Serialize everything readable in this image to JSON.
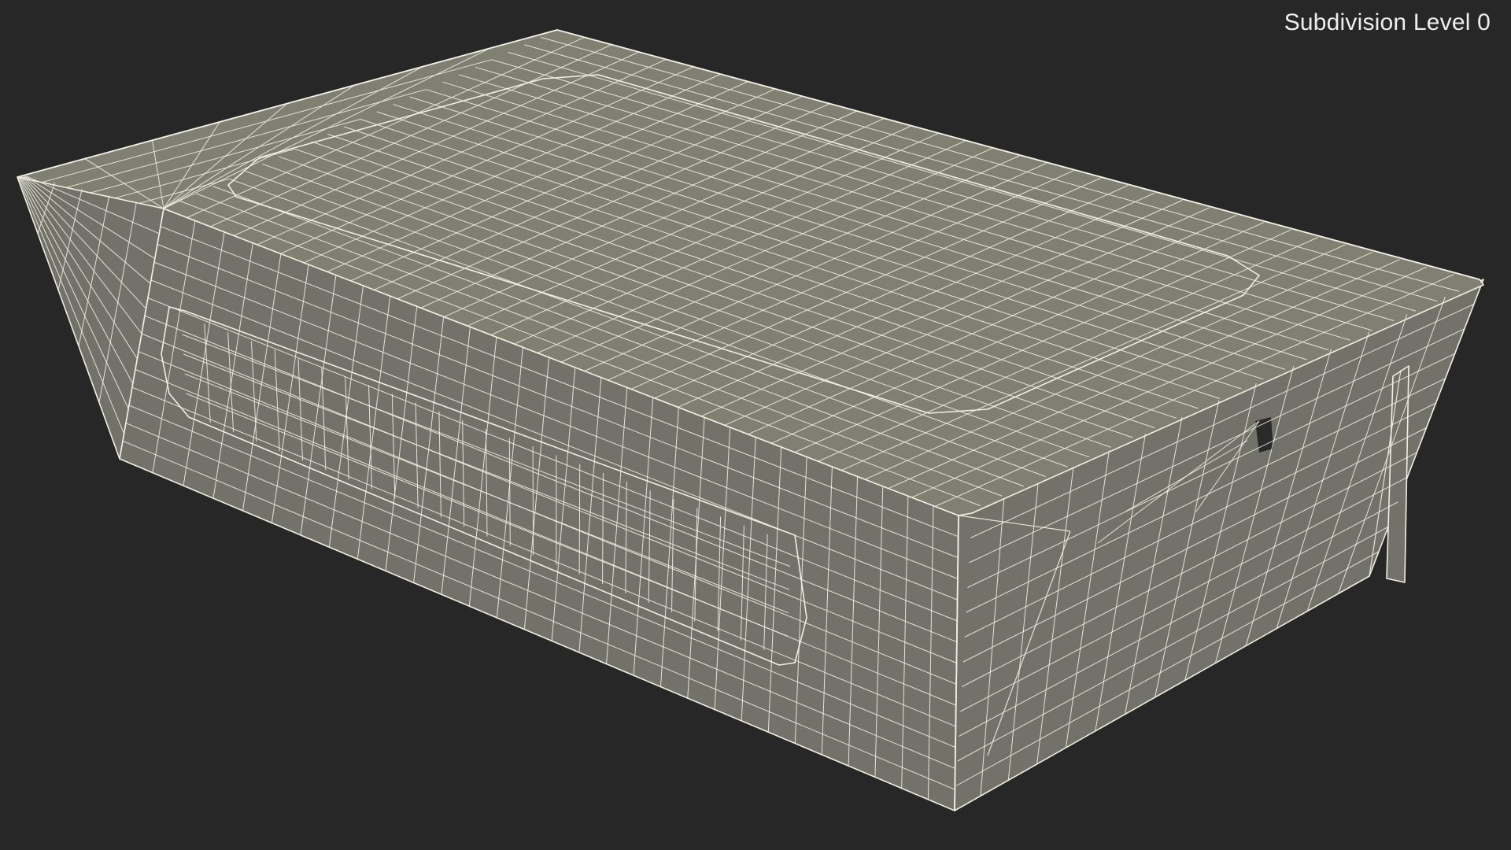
{
  "viewport": {
    "label": "Subdivision Level 0",
    "background_color": "#272727",
    "model_color": "#7f7f72",
    "model_side_color": "#72726a",
    "wire_color": "#f1efe2"
  }
}
